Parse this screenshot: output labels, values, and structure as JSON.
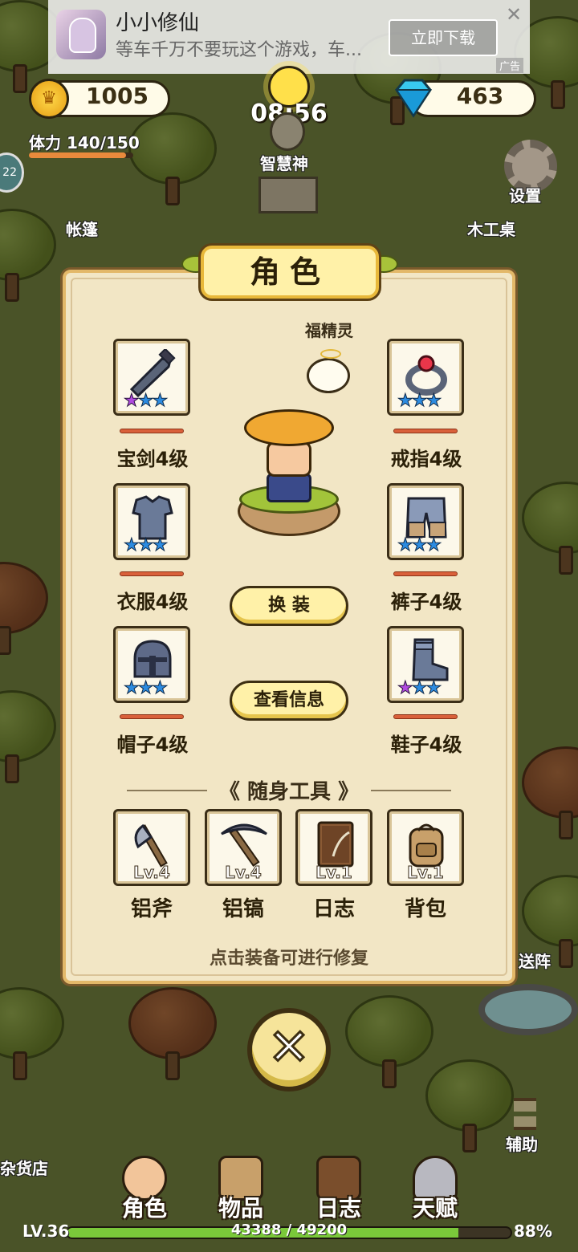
{
  "ad": {
    "title": "小小修仙",
    "description": "等车千万不要玩这个游戏，车...",
    "download_label": "立即下载",
    "close_label": "✕",
    "tag": "广告"
  },
  "hud": {
    "coins": "1005",
    "gems": "463",
    "time": "08:56",
    "stamina_label": "体力 140/150",
    "stamina_fraction": 0.9333
  },
  "map_labels": {
    "statue": "智慧神",
    "settings": "设置",
    "tent": "帐篷",
    "workbench": "木工桌",
    "teleport": "送阵",
    "assist": "辅助",
    "shop": "杂货店"
  },
  "panel": {
    "title": "角色",
    "pet_label": "福精灵",
    "equipment": [
      {
        "id": "sword",
        "label": "宝剑4级",
        "stars": [
          "purple",
          "blue",
          "blue"
        ]
      },
      {
        "id": "ring",
        "label": "戒指4级",
        "stars": [
          "blue",
          "blue",
          "blue"
        ]
      },
      {
        "id": "armor",
        "label": "衣服4级",
        "stars": [
          "blue",
          "blue",
          "blue"
        ]
      },
      {
        "id": "pants",
        "label": "裤子4级",
        "stars": [
          "blue",
          "blue",
          "blue"
        ]
      },
      {
        "id": "helmet",
        "label": "帽子4级",
        "stars": [
          "blue",
          "blue",
          "blue"
        ]
      },
      {
        "id": "boots",
        "label": "鞋子4级",
        "stars": [
          "purple",
          "blue",
          "blue"
        ]
      }
    ],
    "change_outfit_label": "换 装",
    "view_info_label": "查看信息",
    "tools_title": "随身工具",
    "tools_left_mark": "《",
    "tools_right_mark": "》",
    "tools": [
      {
        "label": "铝斧",
        "level": "Lv.4"
      },
      {
        "label": "铝镐",
        "level": "Lv.4"
      },
      {
        "label": "日志",
        "level": "Lv.1"
      },
      {
        "label": "背包",
        "level": "Lv.1"
      }
    ],
    "hint": "点击装备可进行修复"
  },
  "close_glyph": "✕",
  "nav": {
    "items": [
      "角色",
      "物品",
      "日志",
      "天赋"
    ]
  },
  "xp": {
    "level": "LV.36",
    "progress_text": "43388 / 49200",
    "percent_text": "88%",
    "fraction": 0.8819
  },
  "colors": {
    "panel_bg": "#f2e6c5",
    "accent_gold": "#e3b869",
    "star_purple": "#b14be0",
    "star_blue": "#2c8be0",
    "durability": "#d9603a"
  }
}
